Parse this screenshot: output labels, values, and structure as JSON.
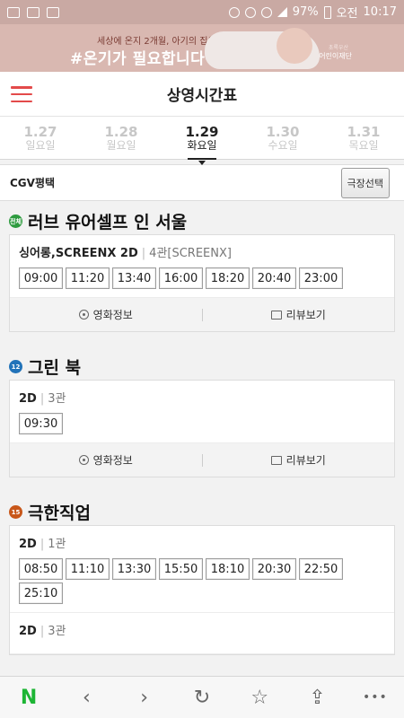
{
  "status_bar": {
    "battery": "97%",
    "ampm": "오전",
    "time": "10:17"
  },
  "banner": {
    "line1": "세상에 온지 2개월, 아기의 집은 보육원",
    "line2": "#온기가 필요합니다",
    "logo_top": "초록우산",
    "logo": "어린이재단"
  },
  "header": {
    "title": "상영시간표",
    "menu_icon": "hamburger-menu-icon"
  },
  "dates": [
    {
      "date": "1.27",
      "day": "일요일",
      "active": false
    },
    {
      "date": "1.28",
      "day": "월요일",
      "active": false
    },
    {
      "date": "1.29",
      "day": "화요일",
      "active": true
    },
    {
      "date": "1.30",
      "day": "수요일",
      "active": false
    },
    {
      "date": "1.31",
      "day": "목요일",
      "active": false
    }
  ],
  "theater": {
    "name": "CGV평택",
    "select_button": "극장선택"
  },
  "colors": {
    "accent": "#e34a4a",
    "rating_all": "#2e9b3f",
    "rating_12": "#2273b9",
    "rating_15": "#c8571a"
  },
  "movies": [
    {
      "title": "러브 유어셀프 인 서울",
      "rating": "전체",
      "slots": [
        {
          "format": "싱어롱,SCREENX 2D",
          "hall": "4관[SCREENX]",
          "times": [
            "09:00",
            "11:20",
            "13:40",
            "16:00",
            "18:20",
            "20:40",
            "23:00"
          ]
        }
      ],
      "info_label": "영화정보",
      "review_label": "리뷰보기"
    },
    {
      "title": "그린 북",
      "rating": "12",
      "slots": [
        {
          "format": "2D",
          "hall": "3관",
          "times": [
            "09:30"
          ]
        }
      ],
      "info_label": "영화정보",
      "review_label": "리뷰보기"
    },
    {
      "title": "극한직업",
      "rating": "15",
      "slots": [
        {
          "format": "2D",
          "hall": "1관",
          "times": [
            "08:50",
            "11:10",
            "13:30",
            "15:50",
            "18:10",
            "20:30",
            "22:50",
            "25:10"
          ]
        },
        {
          "format": "2D",
          "hall": "3관",
          "times": []
        }
      ]
    }
  ],
  "bottom_bar": {
    "naver": "N",
    "back": "‹",
    "forward": "›",
    "refresh": "↻",
    "bookmark": "☆",
    "share": "⇪",
    "more": "•••"
  }
}
